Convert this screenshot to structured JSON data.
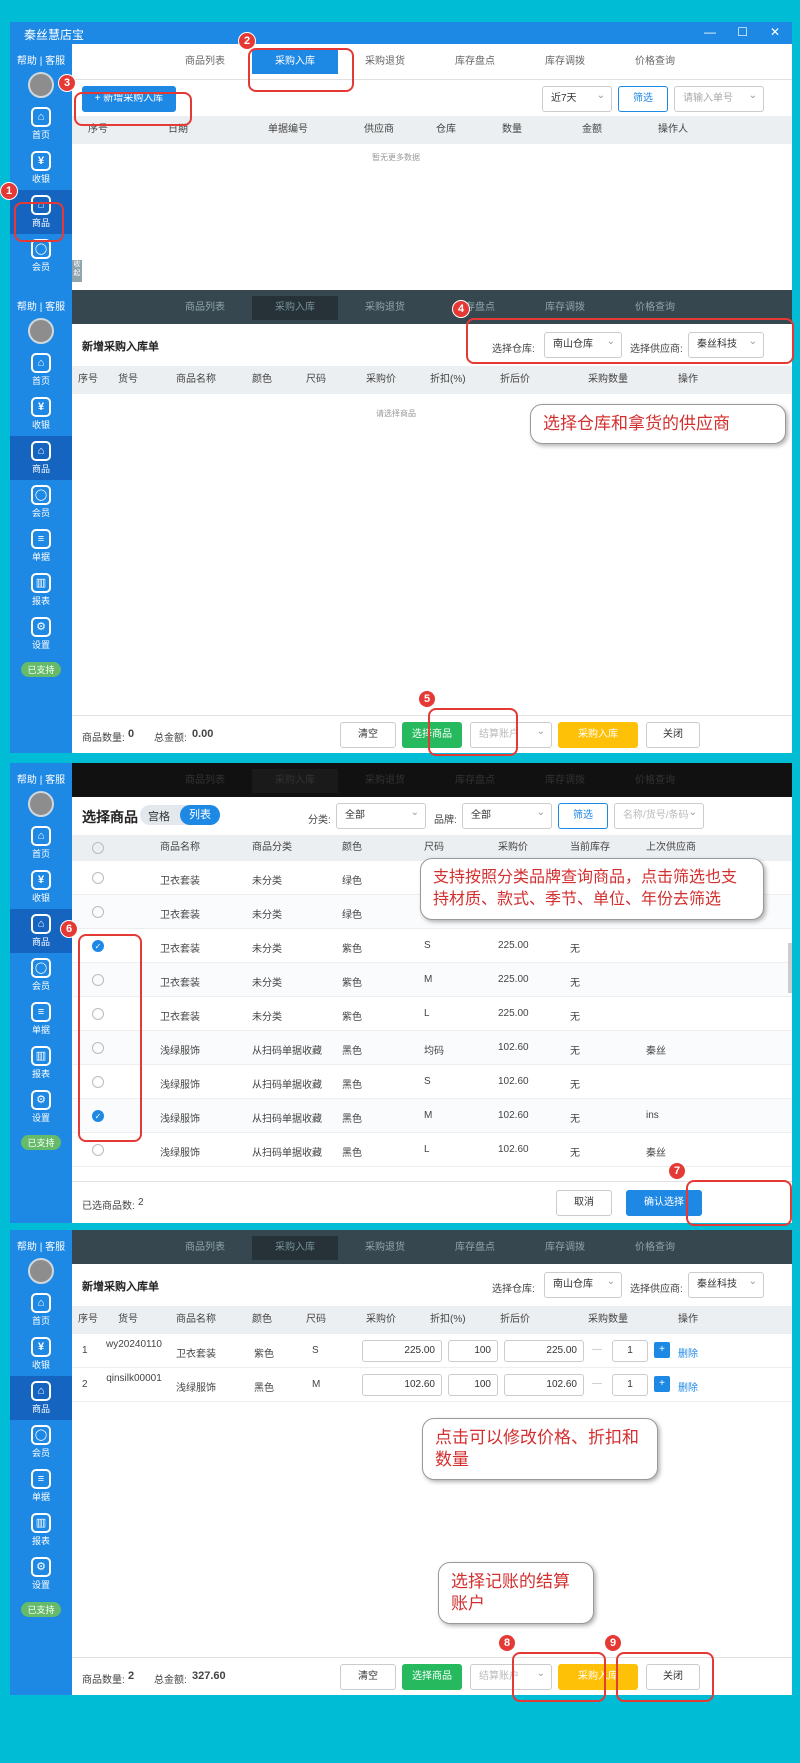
{
  "app": {
    "title": "秦丝慧店宝",
    "help": "帮助 | 客服",
    "support": "已支持"
  },
  "window_controls": {
    "minimize": "—",
    "maximize": "☐",
    "close": "✕"
  },
  "nav": [
    {
      "label": "首页",
      "icon": "⌂"
    },
    {
      "label": "收银",
      "icon": "¥"
    },
    {
      "label": "商品",
      "icon": "⌂"
    },
    {
      "label": "会员",
      "icon": "◯"
    },
    {
      "label": "单据",
      "icon": "≡"
    },
    {
      "label": "报表",
      "icon": "▥"
    },
    {
      "label": "设置",
      "icon": "⚙"
    }
  ],
  "tabs": [
    "商品列表",
    "采购入库",
    "采购退货",
    "库存盘点",
    "库存调拨",
    "价格查询"
  ],
  "side_tag": "收起",
  "s1": {
    "add_btn": "+ 新增采购入库",
    "date_range": "近7天",
    "filter": "筛选",
    "search_ph": "请输入单号",
    "headers": [
      "序号",
      "日期",
      "单据编号",
      "供应商",
      "仓库",
      "数量",
      "金额",
      "操作人"
    ],
    "empty": "暂无更多数据"
  },
  "s2": {
    "title": "新增采购入库单",
    "warehouse_label": "选择仓库:",
    "warehouse": "南山仓库",
    "supplier_label": "选择供应商:",
    "supplier": "秦丝科技",
    "headers": [
      "序号",
      "货号",
      "商品名称",
      "颜色",
      "尺码",
      "采购价",
      "折扣(%)",
      "折后价",
      "采购数量",
      "操作"
    ],
    "empty": "请选择商品",
    "count_label": "商品数量:",
    "count": "0",
    "total_label": "总金额:",
    "total": "0.00",
    "clear": "清空",
    "choose": "选择商品",
    "account_ph": "结算账户",
    "stock_in": "采购入库",
    "close": "关闭"
  },
  "s3": {
    "title": "选择商品",
    "view_grid": "宫格",
    "view_list": "列表",
    "cat_label": "分类:",
    "cat": "全部",
    "brand_label": "品牌:",
    "brand": "全部",
    "filter": "筛选",
    "search_ph": "名称/货号/条码",
    "headers": [
      "商品名称",
      "商品分类",
      "颜色",
      "尺码",
      "采购价",
      "当前库存",
      "上次供应商"
    ],
    "rows": [
      {
        "name": "卫衣套装",
        "cat": "未分类",
        "color": "绿色",
        "size": "",
        "price": "",
        "stock": "",
        "sup": "",
        "on": false
      },
      {
        "name": "卫衣套装",
        "cat": "未分类",
        "color": "绿色",
        "size": "",
        "price": "",
        "stock": "",
        "sup": "",
        "on": false
      },
      {
        "name": "卫衣套装",
        "cat": "未分类",
        "color": "紫色",
        "size": "S",
        "price": "225.00",
        "stock": "无",
        "sup": "",
        "on": true
      },
      {
        "name": "卫衣套装",
        "cat": "未分类",
        "color": "紫色",
        "size": "M",
        "price": "225.00",
        "stock": "无",
        "sup": "",
        "on": false
      },
      {
        "name": "卫衣套装",
        "cat": "未分类",
        "color": "紫色",
        "size": "L",
        "price": "225.00",
        "stock": "无",
        "sup": "",
        "on": false
      },
      {
        "name": "浅绿服饰",
        "cat": "从扫码单据收藏",
        "color": "黑色",
        "size": "均码",
        "price": "102.60",
        "stock": "无",
        "sup": "秦丝",
        "on": false
      },
      {
        "name": "浅绿服饰",
        "cat": "从扫码单据收藏",
        "color": "黑色",
        "size": "S",
        "price": "102.60",
        "stock": "无",
        "sup": "",
        "on": false
      },
      {
        "name": "浅绿服饰",
        "cat": "从扫码单据收藏",
        "color": "黑色",
        "size": "M",
        "price": "102.60",
        "stock": "无",
        "sup": "ins",
        "on": true
      },
      {
        "name": "浅绿服饰",
        "cat": "从扫码单据收藏",
        "color": "黑色",
        "size": "L",
        "price": "102.60",
        "stock": "无",
        "sup": "秦丝",
        "on": false
      }
    ],
    "selected_label": "已选商品数:",
    "selected": "2",
    "cancel": "取消",
    "confirm": "确认选择"
  },
  "s4": {
    "rows": [
      {
        "idx": "1",
        "sku": "wy20240110",
        "name": "卫衣套装",
        "color": "紫色",
        "size": "S",
        "price": "225.00",
        "disc": "100",
        "after": "225.00",
        "qty": "1",
        "op": "删除"
      },
      {
        "idx": "2",
        "sku": "qinsilk00001",
        "name": "浅绿服饰",
        "color": "黑色",
        "size": "M",
        "price": "102.60",
        "disc": "100",
        "after": "102.60",
        "qty": "1",
        "op": "删除"
      }
    ],
    "count": "2",
    "total": "327.60"
  },
  "callouts": {
    "c4": "选择仓库和拿货的供应商",
    "c6": "支持按照分类品牌查询商品，点击筛选也支持材质、款式、季节、单位、年份去筛选",
    "c7": "点击可以修改价格、折扣和数量",
    "c8": "选择记账的结算账户"
  },
  "badges": [
    "1",
    "2",
    "3",
    "4",
    "5",
    "6",
    "7",
    "8",
    "9"
  ]
}
